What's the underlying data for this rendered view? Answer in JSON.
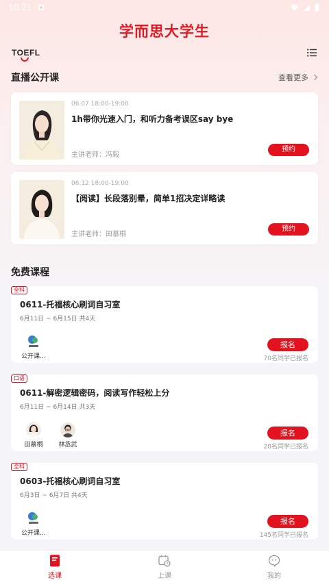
{
  "status_bar": {
    "time": "10:21"
  },
  "app": {
    "title": "学而思大学生",
    "logo_text": "TOEFL"
  },
  "live_section": {
    "title": "直播公开课",
    "more_label": "查看更多",
    "items": [
      {
        "time": "06.07 18:00-19:00",
        "title": "1h带你光速入门，和听力备考误区say bye",
        "teacher": "主讲老师：冯毅",
        "button": "预约"
      },
      {
        "time": "06.12 18:00-19:00",
        "title": "【阅读】长段落别晕，简单1招决定详略读",
        "teacher": "主讲老师：田慕桐",
        "button": "预约"
      }
    ]
  },
  "free_section": {
    "title": "免费课程",
    "items": [
      {
        "tag": "全科",
        "title": "0611-托福核心刷词自习室",
        "date": "6月11日 ~ 6月15日 共4天",
        "teachers": [
          {
            "name": "公开课…",
            "avatar": "public-course-logo"
          }
        ],
        "button": "报名",
        "enrolled": "70名同学已报名"
      },
      {
        "tag": "口语",
        "title": "0611-解密逻辑密码，阅读写作轻松上分",
        "date": "6月11日 ~ 6月14日 共3天",
        "teachers": [
          {
            "name": "田慕桐",
            "avatar": "teacher-avatar"
          },
          {
            "name": "林丞武",
            "avatar": "teacher-avatar"
          }
        ],
        "button": "报名",
        "enrolled": "28名同学已报名"
      },
      {
        "tag": "全科",
        "title": "0603-托福核心刷词自习室",
        "date": "6月3日 ~ 6月7日 共4天",
        "teachers": [
          {
            "name": "公开课…",
            "avatar": "public-course-logo"
          }
        ],
        "button": "报名",
        "enrolled": "145名同学已报名"
      }
    ]
  },
  "tabbar": {
    "tabs": [
      {
        "label": "选课",
        "icon": "book-icon",
        "active": true
      },
      {
        "label": "上课",
        "icon": "calendar-clock-icon",
        "active": false
      },
      {
        "label": "我的",
        "icon": "chat-face-icon",
        "active": false
      }
    ]
  },
  "colors": {
    "accent": "#e3121f",
    "title_red": "#e11b25",
    "background": "#f5f5f7"
  }
}
